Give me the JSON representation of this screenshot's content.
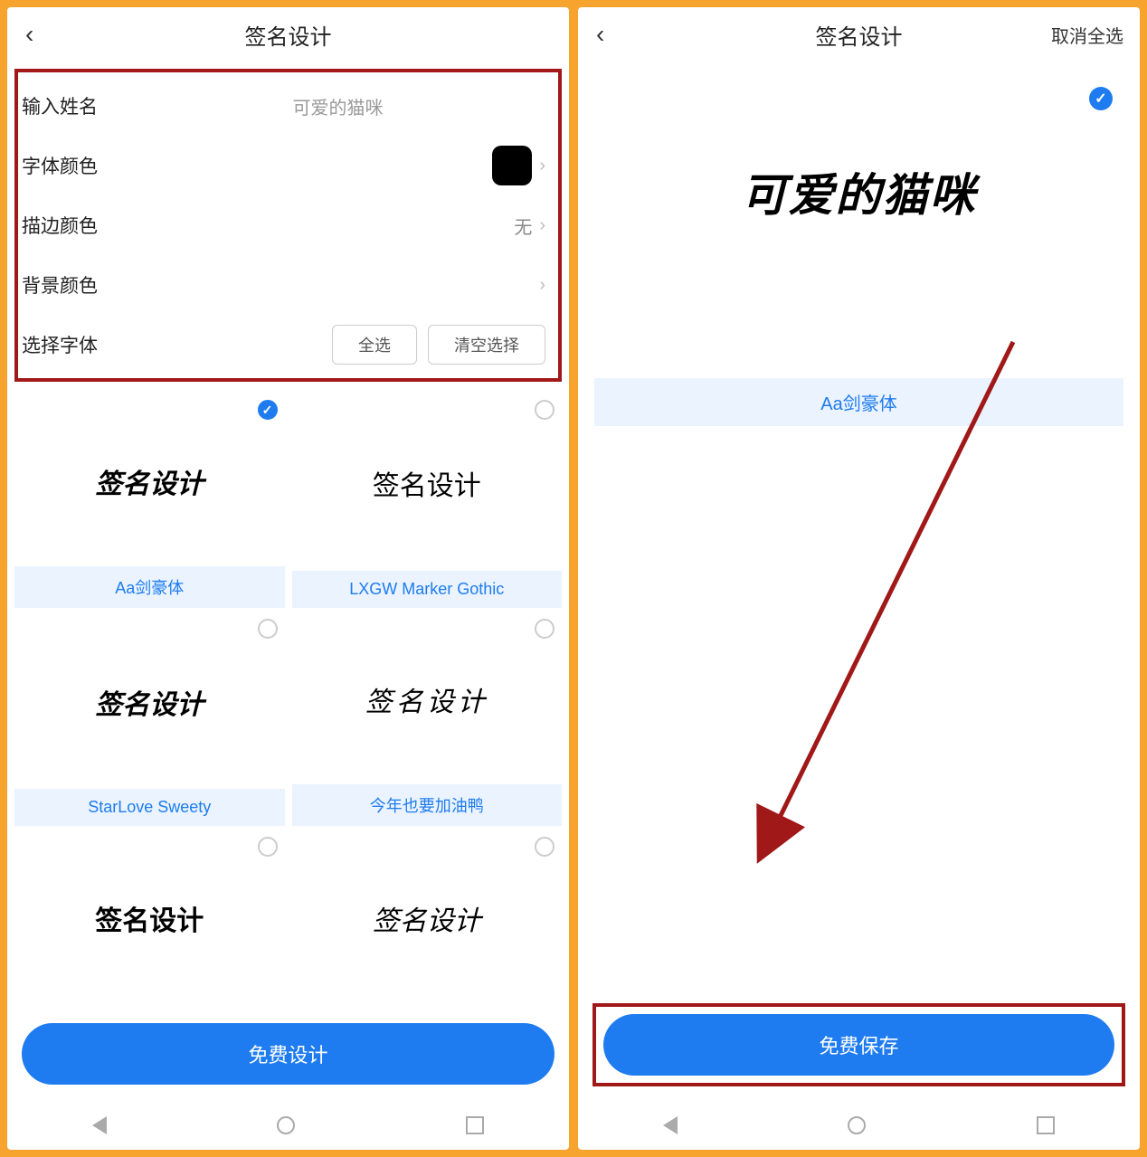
{
  "left": {
    "title": "签名设计",
    "settings": {
      "name_label": "输入姓名",
      "name_value": "可爱的猫咪",
      "font_color_label": "字体颜色",
      "stroke_color_label": "描边颜色",
      "stroke_color_value": "无",
      "bg_color_label": "背景颜色",
      "choose_font_label": "选择字体",
      "select_all": "全选",
      "clear_all": "清空选择"
    },
    "fonts": [
      {
        "preview": "签名设计",
        "name": "Aa剑豪体",
        "selected": true
      },
      {
        "preview": "签名设计",
        "name": "LXGW Marker Gothic",
        "selected": false
      },
      {
        "preview": "签名设计",
        "name": "StarLove Sweety",
        "selected": false
      },
      {
        "preview": "签名设计",
        "name": "今年也要加油鸭",
        "selected": false
      },
      {
        "preview": "签名设计",
        "name": "",
        "selected": false
      },
      {
        "preview": "签名设计",
        "name": "",
        "selected": false
      }
    ],
    "cta": "免费设计"
  },
  "right": {
    "title": "签名设计",
    "action": "取消全选",
    "preview_text": "可爱的猫咪",
    "preview_name": "Aa剑豪体",
    "cta": "免费保存"
  }
}
